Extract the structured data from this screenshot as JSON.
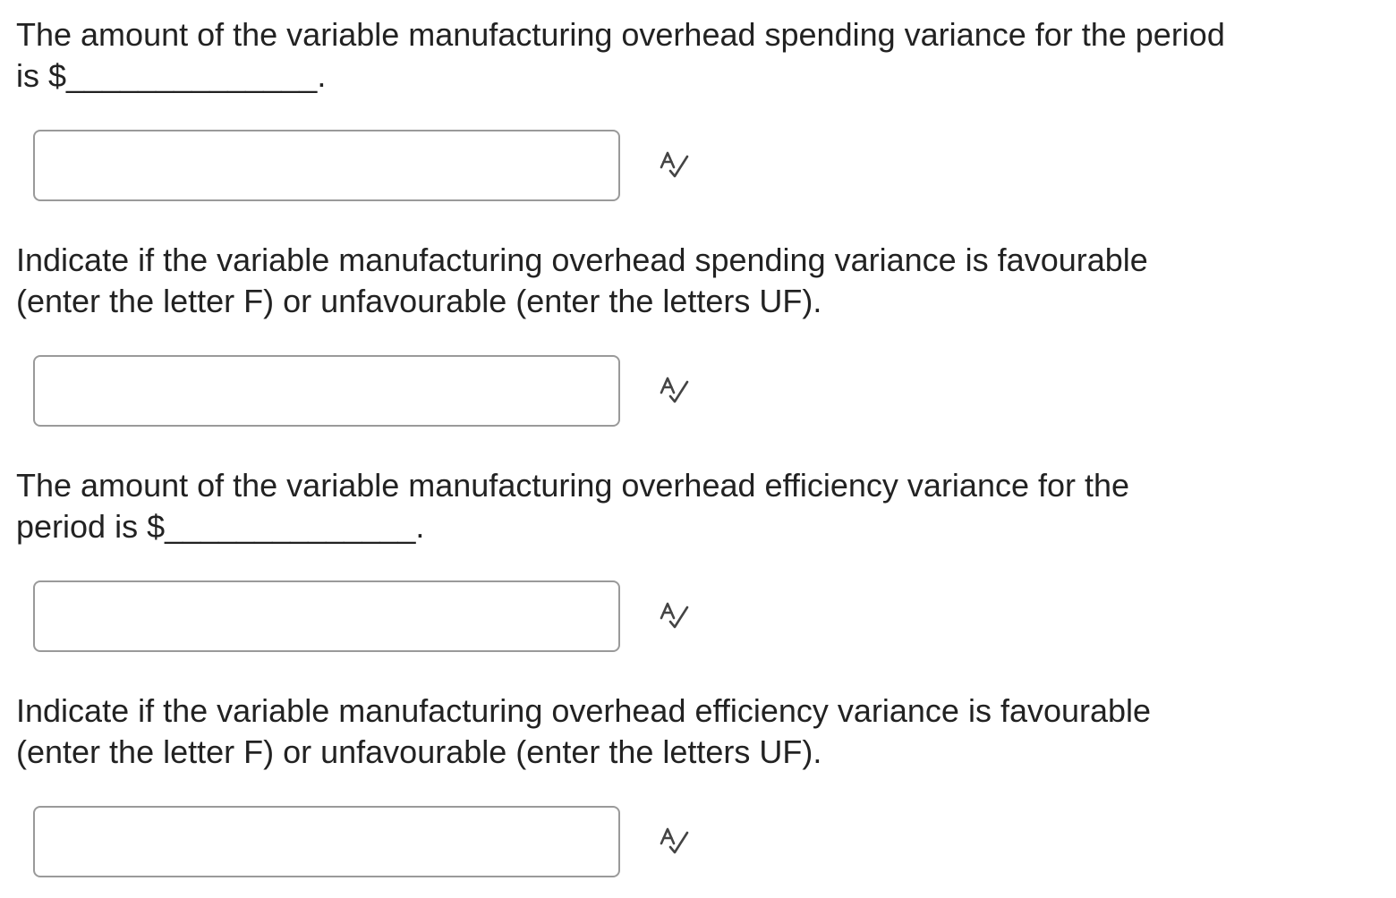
{
  "questions": [
    {
      "line1": "The amount of the variable manufacturing overhead spending variance for the period",
      "line2": "is $______________."
    },
    {
      "line1": "Indicate if the variable manufacturing overhead spending variance is favourable",
      "line2": "(enter the letter F) or unfavourable (enter the letters UF)."
    },
    {
      "line1": "The amount of the variable manufacturing overhead efficiency variance for the",
      "line2": "period is $______________."
    },
    {
      "line1": "Indicate if the variable manufacturing overhead efficiency variance is favourable",
      "line2": "(enter the letter F) or unfavourable (enter the letters UF)."
    }
  ],
  "answers": [
    {
      "value": ""
    },
    {
      "value": ""
    },
    {
      "value": ""
    },
    {
      "value": ""
    }
  ],
  "icons": {
    "spell_check": "spell-check-icon"
  }
}
